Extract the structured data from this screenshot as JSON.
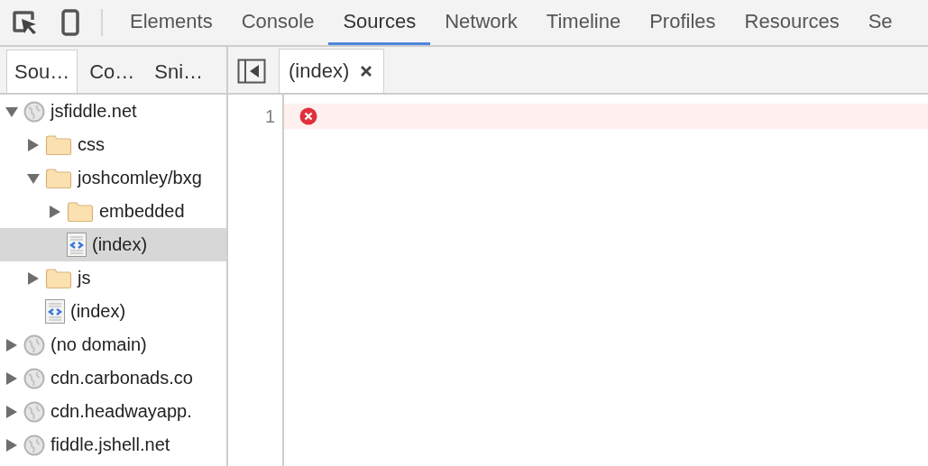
{
  "toolbar": {
    "panels": [
      {
        "label": "Elements",
        "selected": false
      },
      {
        "label": "Console",
        "selected": false
      },
      {
        "label": "Sources",
        "selected": true
      },
      {
        "label": "Network",
        "selected": false
      },
      {
        "label": "Timeline",
        "selected": false
      },
      {
        "label": "Profiles",
        "selected": false
      },
      {
        "label": "Resources",
        "selected": false
      },
      {
        "label": "Se",
        "selected": false
      }
    ]
  },
  "sidebar": {
    "tabs": [
      {
        "label": "Sou…",
        "selected": true
      },
      {
        "label": "Co…",
        "selected": false
      },
      {
        "label": "Sni…",
        "selected": false
      }
    ],
    "tree": [
      {
        "kind": "domain",
        "label": "jsfiddle.net",
        "expanded": true,
        "selected": false,
        "children": [
          {
            "kind": "folder",
            "label": "css",
            "expanded": false,
            "selected": false
          },
          {
            "kind": "folder",
            "label": "joshcomley/bxg",
            "expanded": true,
            "selected": false,
            "children": [
              {
                "kind": "folder",
                "label": "embedded",
                "expanded": false,
                "selected": false
              },
              {
                "kind": "file",
                "label": "(index)",
                "selected": true
              }
            ]
          },
          {
            "kind": "folder",
            "label": "js",
            "expanded": false,
            "selected": false
          },
          {
            "kind": "file",
            "label": "(index)",
            "selected": false
          }
        ]
      },
      {
        "kind": "domain",
        "label": "(no domain)",
        "expanded": false,
        "selected": false
      },
      {
        "kind": "domain",
        "label": "cdn.carbonads.co",
        "expanded": false,
        "selected": false
      },
      {
        "kind": "domain",
        "label": "cdn.headwayapp.",
        "expanded": false,
        "selected": false
      },
      {
        "kind": "domain",
        "label": "fiddle.jshell.net",
        "expanded": false,
        "selected": false
      }
    ]
  },
  "editor": {
    "tabs": [
      {
        "label": "(index)",
        "selected": true
      }
    ],
    "lines": [
      {
        "number": "1",
        "error": true
      }
    ]
  }
}
